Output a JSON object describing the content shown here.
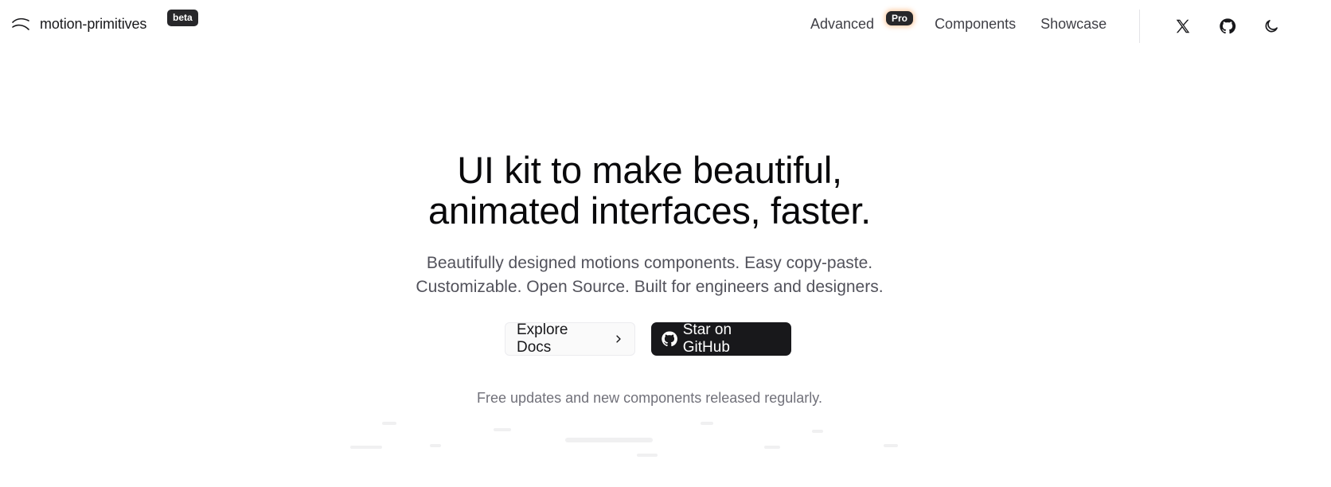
{
  "header": {
    "logo_text": "motion-primitives",
    "beta_badge": "beta",
    "nav": {
      "advanced": "Advanced",
      "pro_badge": "Pro",
      "components": "Components",
      "showcase": "Showcase"
    },
    "icons": [
      "x-logo-icon",
      "github-icon",
      "moon-icon"
    ]
  },
  "hero": {
    "title_line1": "UI kit to make beautiful,",
    "title_line2": "animated interfaces, faster.",
    "subtitle_line1": "Beautifully designed motions components. Easy copy-paste.",
    "subtitle_line2": "Customizable. Open Source. Built for engineers and designers."
  },
  "actions": {
    "docs_label": "Explore Docs",
    "github_label": "Star on GitHub"
  },
  "footnote": "Free updates and new components released regularly.",
  "colors": {
    "text_primary": "#18181b",
    "text_secondary": "#52525b",
    "dark_button": "#18181b",
    "badge_bg": "#27272a"
  }
}
